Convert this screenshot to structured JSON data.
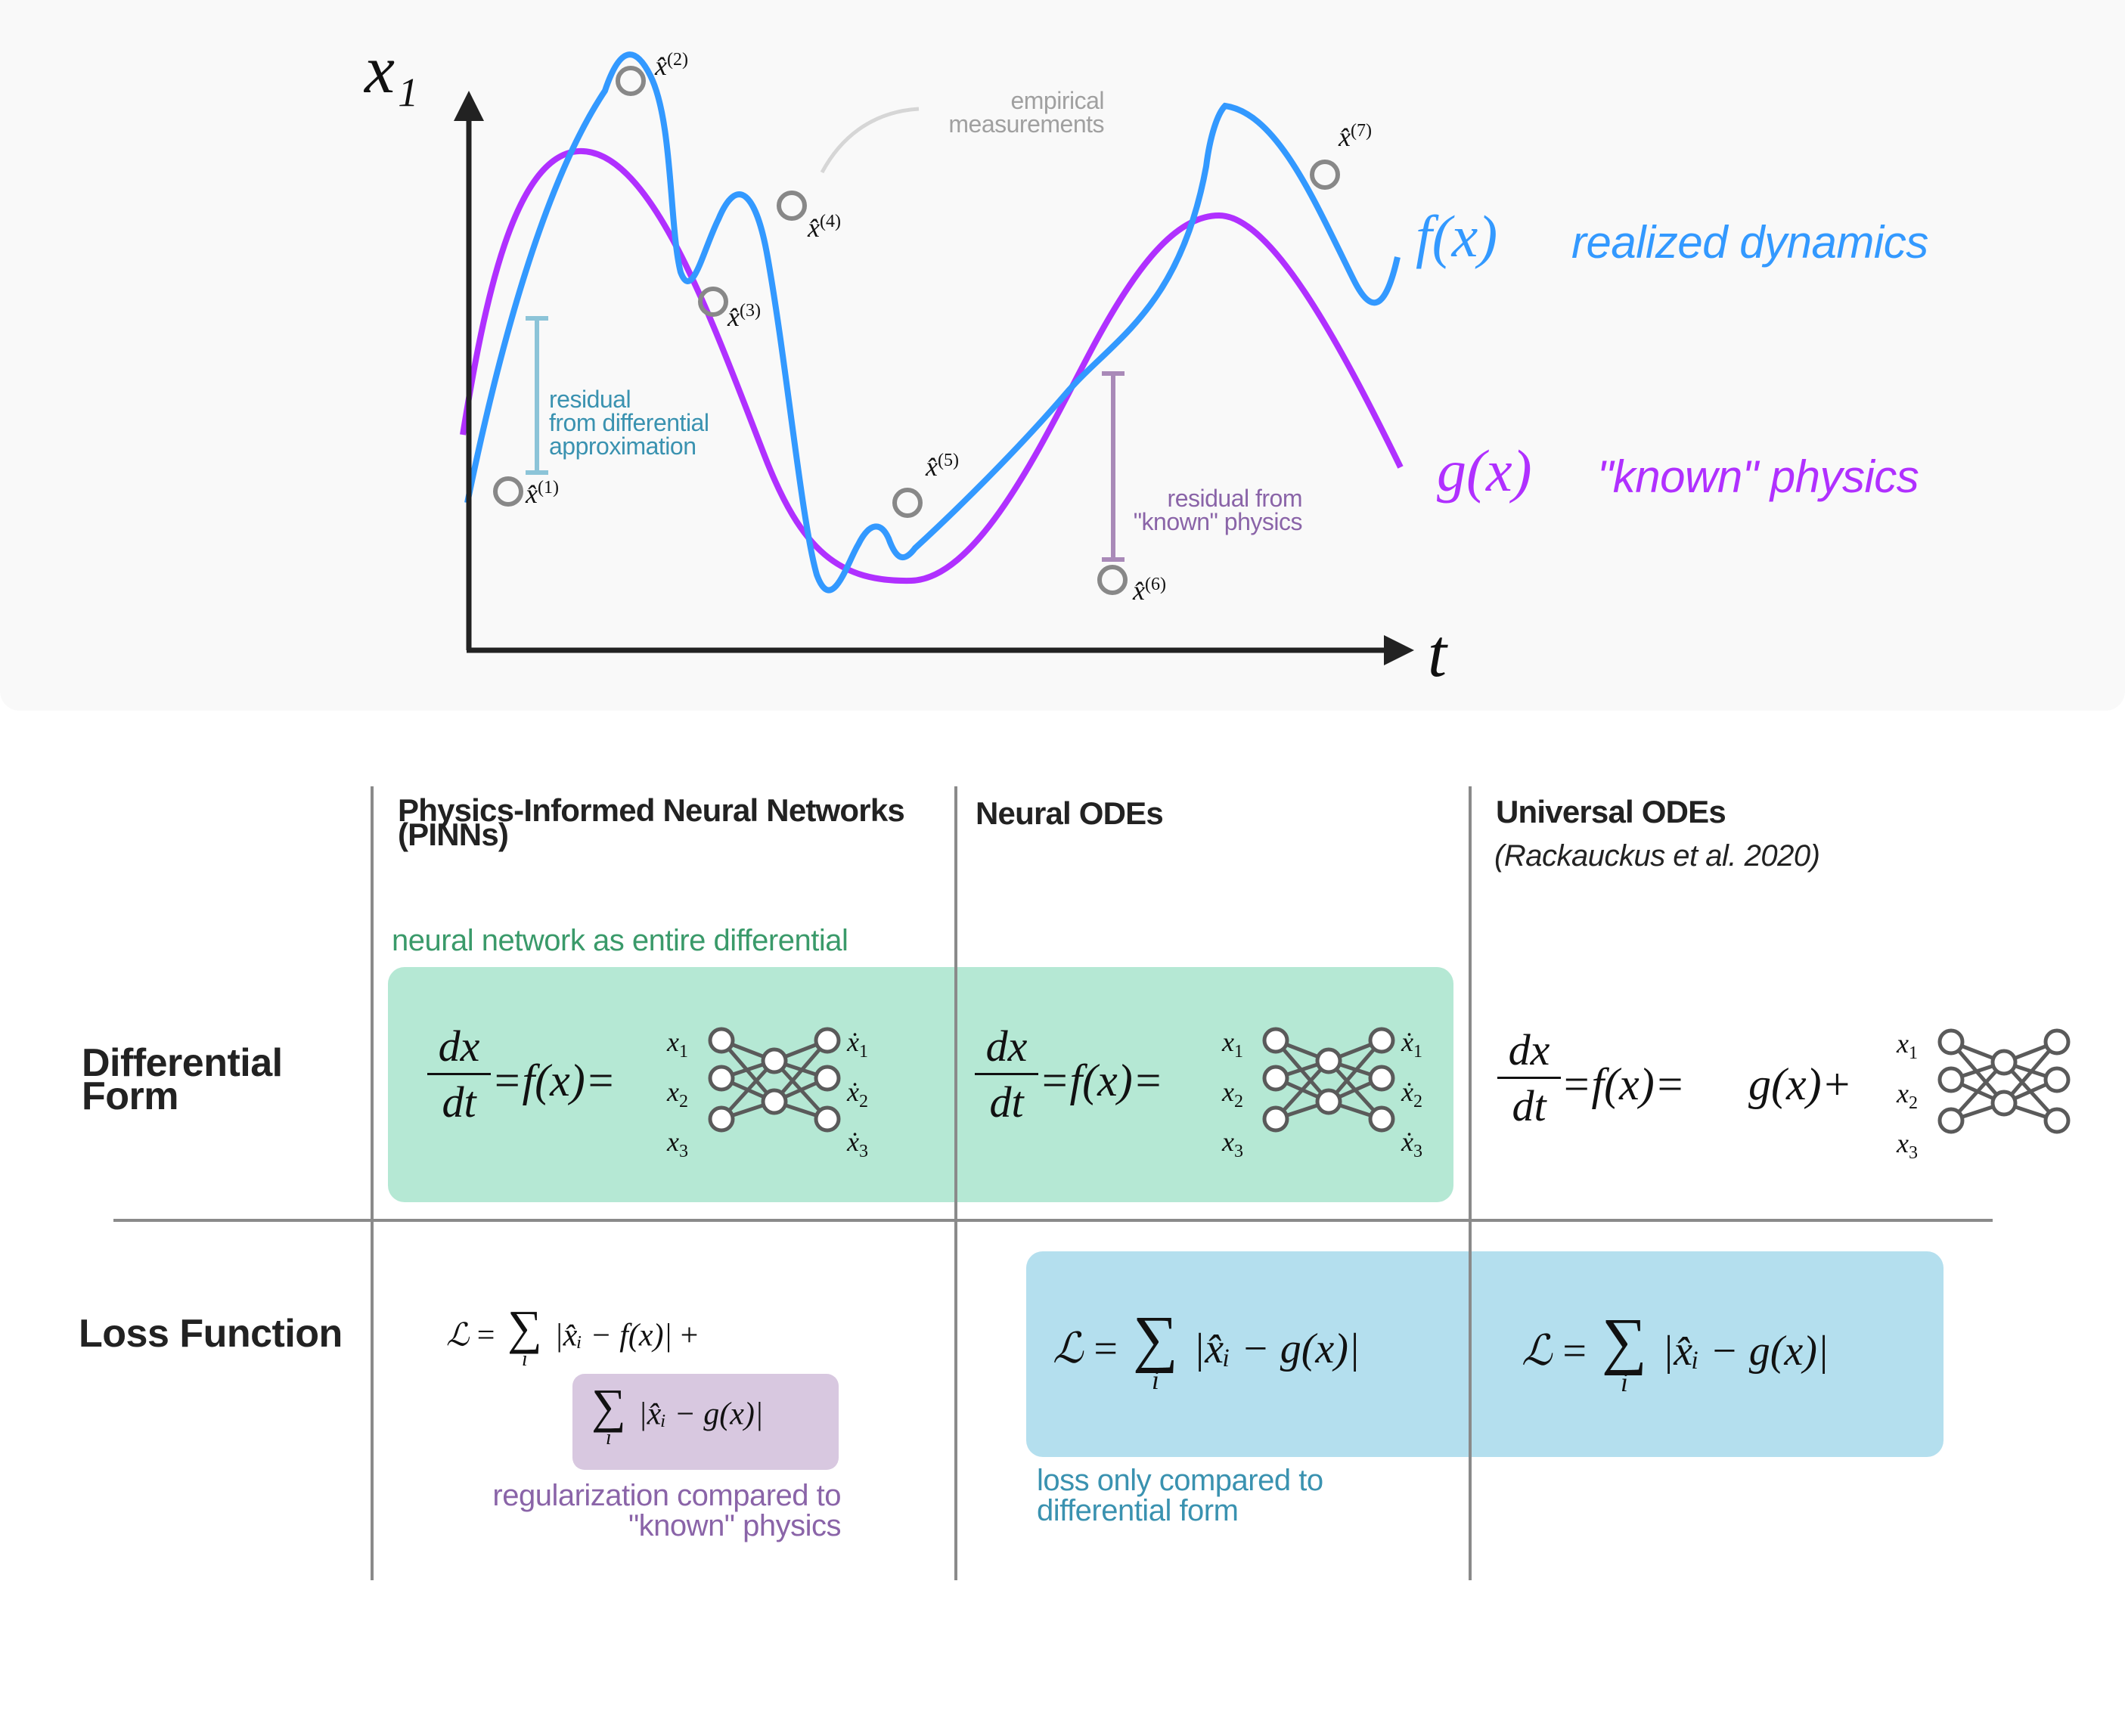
{
  "colors": {
    "panel_bg": "#f9f9f9",
    "realized": "#3399ff",
    "known": "#b030ff",
    "measurement": "#888888",
    "residual_diff": "#8cc4d8",
    "residual_diff_text": "#3a92b0",
    "residual_known": "#a98ab8",
    "residual_known_text": "#8a64a8",
    "green_box": "#b5e8d4",
    "green_text": "#3a9a6a",
    "blue_box": "#b4dfee",
    "blue_text": "#3a92b0",
    "purple_box": "#d8c8e0",
    "purple_text": "#8a64a8",
    "grid_line": "#8a8a8a"
  },
  "plot": {
    "y_axis_label": "x₁",
    "x_axis_label": "t",
    "measurements": [
      {
        "label": "x̂",
        "index": "(1)"
      },
      {
        "label": "x̂",
        "index": "(2)"
      },
      {
        "label": "x̂",
        "index": "(3)"
      },
      {
        "label": "x̂",
        "index": "(4)"
      },
      {
        "label": "x̂",
        "index": "(5)"
      },
      {
        "label": "x̂",
        "index": "(6)"
      },
      {
        "label": "x̂",
        "index": "(7)"
      }
    ],
    "empirical_label": [
      "empirical",
      "measurements"
    ],
    "residual_diff_label": [
      "residual",
      "from differential",
      "approximation"
    ],
    "residual_known_label": [
      "residual from",
      "\"known\" physics"
    ],
    "legend": [
      {
        "symbol": "f(x)",
        "text": "realized dynamics"
      },
      {
        "symbol": "g(x)",
        "text": "\"known\" physics"
      }
    ]
  },
  "table": {
    "columns": [
      {
        "title": "Physics-Informed Neural Networks",
        "title2": "(PINNs)"
      },
      {
        "title": "Neural ODEs"
      },
      {
        "title": "Universal ODEs",
        "subtitle": "(Rackauckus et al. 2020)"
      }
    ],
    "rows": [
      {
        "label": "Differential",
        "label2": "Form"
      },
      {
        "label": "Loss Function"
      }
    ],
    "green_note": "neural network as entire differential",
    "diff_form": {
      "lhs_num": "dx",
      "lhs_den": "dt",
      "eq_f": "=f(x)=",
      "g_plus": "g(x)+",
      "inputs": [
        "x",
        "x",
        "x"
      ],
      "input_subs": [
        "1",
        "2",
        "3"
      ],
      "outputs": [
        "ẋ",
        "ẋ",
        "ẋ"
      ]
    },
    "loss": {
      "L": "ℒ",
      "eq": "=",
      "sum": "∑",
      "sub_i": "i",
      "term_f": "|x̂ᵢ − f(x)|",
      "plus": "+",
      "term_g": "|x̂ᵢ − g(x)|"
    },
    "purple_note": [
      "regularization compared to",
      "\"known\" physics"
    ],
    "blue_note": [
      "loss only compared to",
      "differential form"
    ]
  }
}
